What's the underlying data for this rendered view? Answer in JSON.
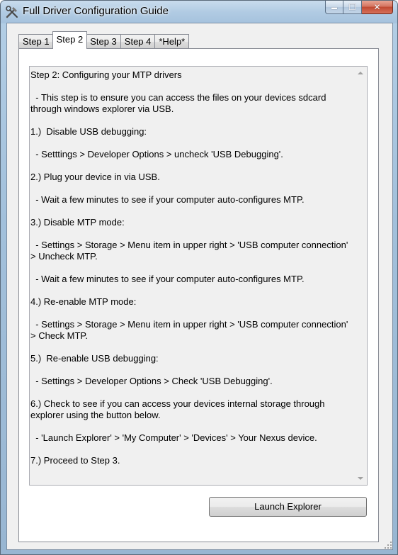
{
  "window": {
    "title": "Full Driver Configuration Guide",
    "icon": "tools-icon"
  },
  "caption_buttons": {
    "minimize_icon": "minimize-icon",
    "maximize_icon": "maximize-icon",
    "close_icon": "close-icon",
    "close_glyph": "✕",
    "minimize_glyph": "▬",
    "maximize_glyph": "☐"
  },
  "tabs": [
    {
      "label": "Step 1",
      "active": false
    },
    {
      "label": "Step 2",
      "active": true
    },
    {
      "label": "Step 3",
      "active": false
    },
    {
      "label": "Step 4",
      "active": false
    },
    {
      "label": "*Help*",
      "active": false
    }
  ],
  "instructions": {
    "text": "Step 2: Configuring your MTP drivers\n\n  - This step is to ensure you can access the files on your devices sdcard through windows explorer via USB.\n\n1.)  Disable USB debugging:\n\n  - Setttings > Developer Options > uncheck 'USB Debugging'.\n\n2.) Plug your device in via USB.\n\n  - Wait a few minutes to see if your computer auto-configures MTP.\n\n3.) Disable MTP mode:\n\n  - Settings > Storage > Menu item in upper right > 'USB computer connection' > Uncheck MTP.\n\n  - Wait a few minutes to see if your computer auto-configures MTP.\n\n4.) Re-enable MTP mode:\n\n  - Settings > Storage > Menu item in upper right > 'USB computer connection' > Check MTP.\n\n5.)  Re-enable USB debugging:\n\n  - Settings > Developer Options > Check 'USB Debugging'.\n\n6.) Check to see if you can access your devices internal storage through explorer using the button below.\n\n  - 'Launch Explorer' > 'My Computer' > 'Devices' > Your Nexus device.\n\n7.) Proceed to Step 3."
  },
  "buttons": {
    "launch_explorer": "Launch Explorer"
  },
  "colors": {
    "titlebar": "#b1cbe3",
    "close_button": "#c04a32",
    "dialog_background": "#f0f0f0"
  }
}
